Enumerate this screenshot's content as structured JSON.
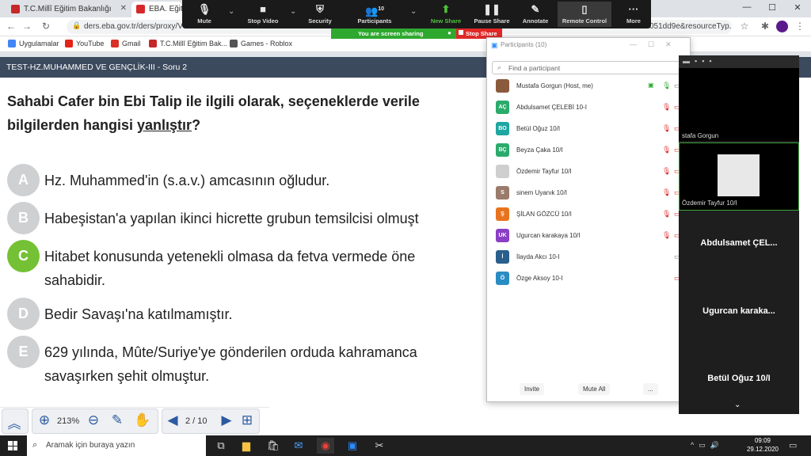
{
  "browser": {
    "tabs": [
      {
        "label": "T.C.Millî Eğitim Bakanlığı",
        "active": false
      },
      {
        "label": "EBA. Eğitim",
        "active": true
      }
    ],
    "url_left": "ders.eba.gov.tr/ders/proxy/VCollab",
    "url_right": "051dd9e&resourceTyp...",
    "bookmarks": [
      "Uygulamalar",
      "YouTube",
      "Gmail",
      "T.C.Millî Eğitim Bak...",
      "Games - Roblox"
    ]
  },
  "zoom_toolbar": {
    "items": [
      {
        "label": "Mute",
        "icon": "mic-icon"
      },
      {
        "label": "Stop Video",
        "icon": "video-camera-icon"
      },
      {
        "label": "Security",
        "icon": "shield-icon"
      },
      {
        "label": "Participants",
        "icon": "participants-icon",
        "badge": "10"
      },
      {
        "label": "New Share",
        "icon": "share-arrow-icon"
      },
      {
        "label": "Pause Share",
        "icon": "pause-icon"
      },
      {
        "label": "Annotate",
        "icon": "pen-icon"
      },
      {
        "label": "Remote Control",
        "icon": "mouse-icon"
      },
      {
        "label": "More",
        "icon": "dots-icon"
      }
    ],
    "sharing_text": "You are screen sharing",
    "stop_share": "Stop Share"
  },
  "eba": {
    "header_title": "TEST-HZ.MUHAMMED VE GENÇLİK-III - Soru 2",
    "question_part1": "Sahabi Cafer bin Ebi Talip ile ilgili olarak, seçeneklerde verile",
    "question_part2": "bilgilerden hangisi ",
    "question_underlined": "yanlıştır",
    "question_end": "?",
    "options": [
      {
        "letter": "A",
        "line1": "Hz. Muhammed'in (s.a.v.) amcasının oğludur.",
        "line2": ""
      },
      {
        "letter": "B",
        "line1": "Habeşistan'a yapılan ikinci hicrette grubun temsilcisi olmuşt",
        "line2": ""
      },
      {
        "letter": "C",
        "line1": "Hitabet konusunda yetenekli olmasa da fetva vermede öne",
        "line2": "sahabidir."
      },
      {
        "letter": "D",
        "line1": "Bedir Savaşı'na katılmamıştır.",
        "line2": ""
      },
      {
        "letter": "E",
        "line1": "629 yılında, Mûte/Suriye'ye gönderilen orduda kahramanca",
        "line2": "savaşırken şehit olmuştur."
      }
    ],
    "selected": "C",
    "zoom": "213%",
    "page": "2 / 10"
  },
  "participants_panel": {
    "title": "Participants (10)",
    "search_placeholder": "Find a participant",
    "participants": [
      {
        "initials": "",
        "name": "Mustafa Gorgun (Host, me)",
        "color": "#8a5a3c"
      },
      {
        "initials": "AÇ",
        "name": "Abdulsamet ÇELEBİ 10-I",
        "color": "#2bab6b"
      },
      {
        "initials": "BO",
        "name": "Betül Oğuz 10/I",
        "color": "#1ea7a0"
      },
      {
        "initials": "BÇ",
        "name": "Beyza Çaka 10/I",
        "color": "#2bab6b"
      },
      {
        "initials": "",
        "name": "Özdemir Tayfur 10/I",
        "color": "#cfcfcf"
      },
      {
        "initials": "S",
        "name": "sinem Uyanık 10/I",
        "color": "#9a7b6b"
      },
      {
        "initials": "Ş",
        "name": "ŞİLAN GÖZCÜ 10/I",
        "color": "#e8731e"
      },
      {
        "initials": "UK",
        "name": "Ugurcan karakaya 10/I",
        "color": "#8a3fc4"
      },
      {
        "initials": "İ",
        "name": "İlayda Akcı 10-I",
        "color": "#2a5f8c"
      },
      {
        "initials": "Ö",
        "name": "Özge Aksoy 10-I",
        "color": "#2a8cc4"
      }
    ],
    "invite": "Invite",
    "mute_all": "Mute All",
    "more": "..."
  },
  "video_panel": {
    "tile1_name": "stafa Gorgun",
    "tile2_name": "Özdemir Tayfur 10/I",
    "tile3_name": "Abdulsamet ÇEL...",
    "tile4_name": "Ugurcan karaka...",
    "tile5_name": "Betül Oğuz 10/I"
  },
  "taskbar": {
    "search": "Aramak için buraya yazın",
    "time": "09:09",
    "date": "29.12.2020"
  }
}
